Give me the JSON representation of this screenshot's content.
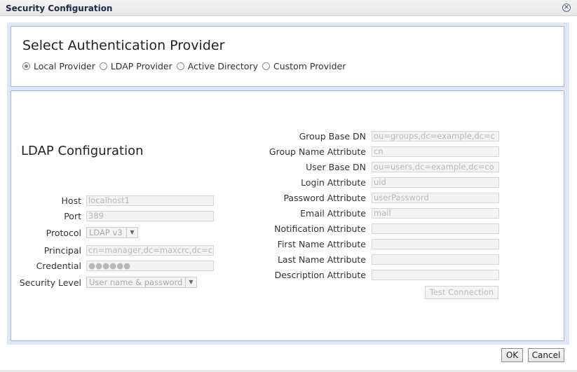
{
  "window": {
    "title": "Security Configuration"
  },
  "provider": {
    "heading": "Select Authentication Provider",
    "options": [
      {
        "label": "Local Provider",
        "checked": true
      },
      {
        "label": "LDAP Provider",
        "checked": false
      },
      {
        "label": "Active Directory",
        "checked": false
      },
      {
        "label": "Custom Provider",
        "checked": false
      }
    ]
  },
  "ldap": {
    "heading": "LDAP Configuration",
    "host": {
      "label": "Host",
      "value": "localhost1"
    },
    "port": {
      "label": "Port",
      "value": "389"
    },
    "protocol": {
      "label": "Protocol",
      "value": "LDAP v3"
    },
    "principal": {
      "label": "Principal",
      "value": "cn=manager,dc=maxcrc,dc=c"
    },
    "credential": {
      "label": "Credential",
      "value": "●●●●●●"
    },
    "security_level": {
      "label": "Security Level",
      "value": "User name & password"
    },
    "group_base_dn": {
      "label": "Group Base DN",
      "value": "ou=groups,dc=example,dc=c"
    },
    "group_name_attribute": {
      "label": "Group Name Attribute",
      "value": "cn"
    },
    "user_base_dn": {
      "label": "User Base DN",
      "value": "ou=users,dc=example,dc=co"
    },
    "login_attribute": {
      "label": "Login Attribute",
      "value": "uid"
    },
    "password_attribute": {
      "label": "Password Attribute",
      "value": "userPassword"
    },
    "email_attribute": {
      "label": "Email Attribute",
      "value": "mail"
    },
    "notification_attribute": {
      "label": "Notification Attribute",
      "value": ""
    },
    "first_name_attribute": {
      "label": "First Name Attribute",
      "value": ""
    },
    "last_name_attribute": {
      "label": "Last Name Attribute",
      "value": ""
    },
    "description_attribute": {
      "label": "Description Attribute",
      "value": ""
    },
    "test_connection_label": "Test Connection"
  },
  "footer": {
    "ok_label": "OK",
    "cancel_label": "Cancel"
  },
  "icons": {
    "close": "close-icon",
    "dropdown": "chevron-down-icon"
  }
}
